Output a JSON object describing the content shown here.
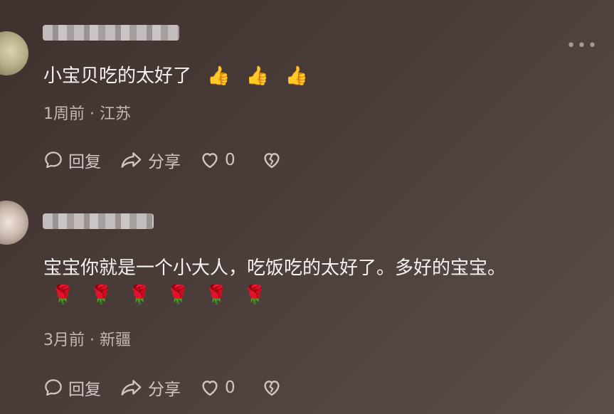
{
  "comments": [
    {
      "text": "小宝贝吃的太好了",
      "emojis": [
        "👍",
        "👍",
        "👍"
      ],
      "meta": "1周前 · 江苏",
      "actions": {
        "reply": "回复",
        "share": "分享",
        "likes": "0"
      }
    },
    {
      "text": "宝宝你就是一个小大人，吃饭吃的太好了。多好的宝宝。",
      "flowers": [
        "🌹",
        "🌹",
        "🌹",
        "🌹",
        "🌹",
        "🌹"
      ],
      "meta": "3月前 · 新疆",
      "actions": {
        "reply": "回复",
        "share": "分享",
        "likes": "0"
      }
    }
  ],
  "more_label": "•••",
  "icons": {
    "reply": "comment-bubble-icon",
    "share": "share-arrow-icon",
    "like": "heart-icon",
    "dislike": "broken-heart-icon"
  }
}
